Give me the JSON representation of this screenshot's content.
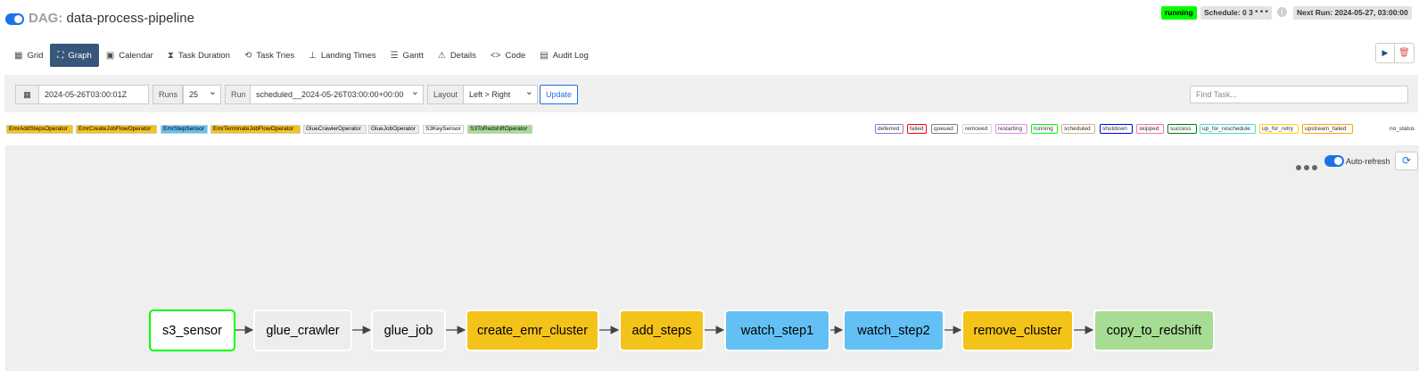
{
  "header": {
    "prefix": "DAG:",
    "dag_name": "data-process-pipeline",
    "state": "running",
    "schedule": "Schedule: 0 3 * * *",
    "info_glyph": "i",
    "next_run": "Next Run: 2024-05-27, 03:00:00"
  },
  "tabs": [
    {
      "label": "Grid",
      "icon": "grid-icon",
      "glyph": "▦"
    },
    {
      "label": "Graph",
      "icon": "graph-icon",
      "glyph": "⛶"
    },
    {
      "label": "Calendar",
      "icon": "calendar-icon",
      "glyph": "▣"
    },
    {
      "label": "Task Duration",
      "icon": "hourglass-icon",
      "glyph": "⧗"
    },
    {
      "label": "Task Tries",
      "icon": "retry-icon",
      "glyph": "⟲"
    },
    {
      "label": "Landing Times",
      "icon": "landing-icon",
      "glyph": "⊥"
    },
    {
      "label": "Gantt",
      "icon": "gantt-icon",
      "glyph": "☰"
    },
    {
      "label": "Details",
      "icon": "warning-icon",
      "glyph": "⚠"
    },
    {
      "label": "Code",
      "icon": "code-icon",
      "glyph": "<>"
    },
    {
      "label": "Audit Log",
      "icon": "document-icon",
      "glyph": "▤"
    }
  ],
  "actions": {
    "trigger_glyph": "▶",
    "delete_glyph": "🗑"
  },
  "controls": {
    "date_icon": "▦",
    "base_date": "2024-05-26T03:00:01Z",
    "runs_label": "Runs",
    "runs_value": "25",
    "run_label": "Run",
    "run_value": "scheduled__2024-05-26T03:00:00+00:00",
    "layout_label": "Layout",
    "layout_value": "Left > Right",
    "update_label": "Update",
    "find_placeholder": "Find Task..."
  },
  "operator_legend": [
    {
      "label": "EmrAddStepsOperator",
      "color": "#f4c31a"
    },
    {
      "label": "EmrCreateJobFlowOperator",
      "color": "#f4c31a"
    },
    {
      "label": "EmrStepSensor",
      "color": "#62c0f4"
    },
    {
      "label": "EmrTerminateJobFlowOperator",
      "color": "#f4c31a"
    },
    {
      "label": "GlueCrawlerOperator",
      "color": "#ededed"
    },
    {
      "label": "GlueJobOperator",
      "color": "#ededed"
    },
    {
      "label": "S3KeySensor",
      "color": "#ffffff"
    },
    {
      "label": "S3ToRedshiftOperator",
      "color": "#a6dc93"
    }
  ],
  "status_legend": [
    {
      "label": "deferred",
      "color": "#9370db"
    },
    {
      "label": "failed",
      "color": "#ff0000"
    },
    {
      "label": "queued",
      "color": "#808080"
    },
    {
      "label": "removed",
      "color": "#d3d3d3"
    },
    {
      "label": "restarting",
      "color": "#ee82ee"
    },
    {
      "label": "running",
      "color": "#00ff00"
    },
    {
      "label": "scheduled",
      "color": "#d2b48c"
    },
    {
      "label": "shutdown",
      "color": "#0000ff"
    },
    {
      "label": "skipped",
      "color": "#ff69b4"
    },
    {
      "label": "success",
      "color": "#008000"
    },
    {
      "label": "up_for_reschedule",
      "color": "#40e0d0"
    },
    {
      "label": "up_for_retry",
      "color": "#ffd700"
    },
    {
      "label": "upstream_failed",
      "color": "#ffa500"
    }
  ],
  "status_none": "no_status",
  "graph": {
    "auto_refresh_label": "Auto-refresh",
    "refresh_glyph": "⟳",
    "nodes": [
      {
        "label": "s3_sensor",
        "color": "#ffffff",
        "status": "running"
      },
      {
        "label": "glue_crawler",
        "color": "#ededed"
      },
      {
        "label": "glue_job",
        "color": "#ededed"
      },
      {
        "label": "create_emr_cluster",
        "color": "#f4c31a"
      },
      {
        "label": "add_steps",
        "color": "#f4c31a"
      },
      {
        "label": "watch_step1",
        "color": "#62c0f4"
      },
      {
        "label": "watch_step2",
        "color": "#62c0f4"
      },
      {
        "label": "remove_cluster",
        "color": "#f4c31a"
      },
      {
        "label": "copy_to_redshift",
        "color": "#a6dc93"
      }
    ]
  }
}
